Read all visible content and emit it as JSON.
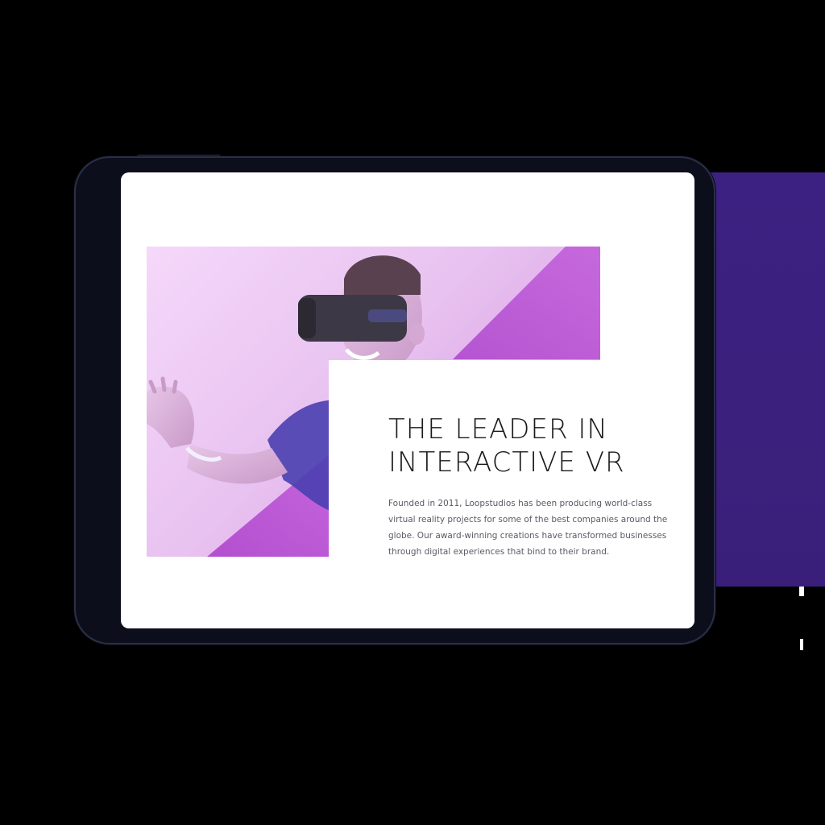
{
  "hero": {
    "image_alt": "Man wearing a VR headset",
    "gradient_colors": [
      "#f5d8fa",
      "#c76ad8"
    ]
  },
  "about": {
    "headline_line1": "THE LEADER IN",
    "headline_line2": "INTERACTIVE VR",
    "body": "Founded in 2011, Loopstudios has been producing world-class virtual reality projects for some of the best companies around the globe. Our award-winning creations have transformed businesses through digital experiences that bind to their brand."
  },
  "colors": {
    "device": "#0c0e1c",
    "backdrop": "#3d2182",
    "screen": "#ffffff",
    "headline": "#1a1a1a",
    "body": "#5a5a66"
  }
}
